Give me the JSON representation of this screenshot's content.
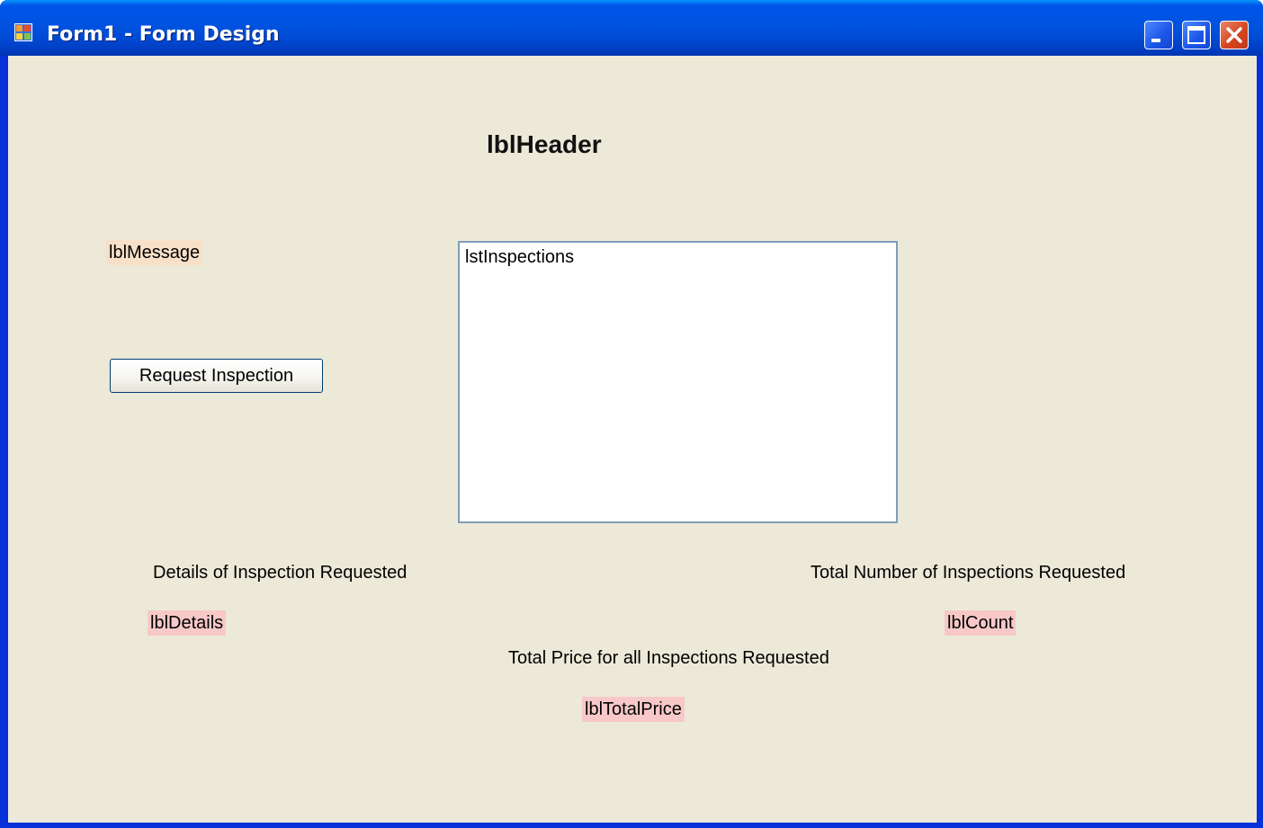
{
  "window": {
    "title": "Form1 - Form Design"
  },
  "form": {
    "header": "lblHeader",
    "message": "lblMessage",
    "request_button": "Request Inspection",
    "listbox": {
      "items": [
        "lstInspections"
      ]
    },
    "details_caption": "Details of Inspection Requested",
    "details_value": "lblDetails",
    "count_caption": "Total Number of Inspections Requested",
    "count_value": "lblCount",
    "total_price_caption": "Total Price for all Inspections Requested",
    "total_price_value": "lblTotalPrice"
  },
  "icons": {
    "app": "form-app-icon",
    "minimize": "minimize-icon",
    "maximize": "maximize-icon",
    "close": "close-icon"
  },
  "colors": {
    "client_background": "#ece9d8",
    "titlebar": "#0055e5",
    "peach_label": "#f8e0c8",
    "pink_label": "#f8c8c8"
  }
}
